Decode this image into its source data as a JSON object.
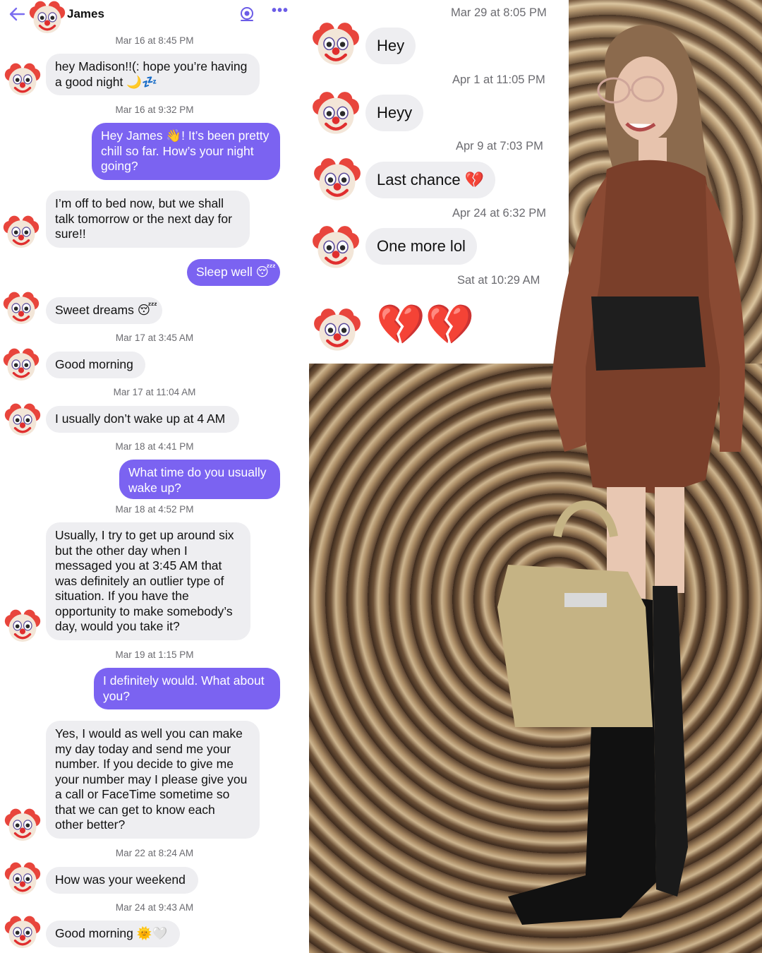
{
  "header": {
    "contact_name": "James",
    "back_icon": "arrow-left-icon",
    "action_icon": "broadcast-icon",
    "more_label": "•••"
  },
  "avatar_emoji": "clown-face-icon",
  "left_thread": [
    {
      "kind": "ts",
      "text": "Mar 16 at 8:45 PM"
    },
    {
      "kind": "in",
      "lines": [
        "hey Madison!!(: hope you’re having",
        "a good night 🌙💤"
      ]
    },
    {
      "kind": "ts",
      "text": "Mar 16 at 9:32 PM"
    },
    {
      "kind": "out",
      "lines": [
        "Hey James 👋! It’s been pretty",
        "chill so far. How’s your night",
        "going?"
      ]
    },
    {
      "kind": "in",
      "lines": [
        "I’m off to bed now, but we shall",
        "talk tomorrow or the next day for",
        "sure!!"
      ]
    },
    {
      "kind": "out",
      "lines": [
        "Sleep well 😴"
      ]
    },
    {
      "kind": "in",
      "lines": [
        "Sweet dreams 😴"
      ]
    },
    {
      "kind": "ts",
      "text": "Mar 17 at 3:45 AM"
    },
    {
      "kind": "in",
      "lines": [
        "Good morning"
      ]
    },
    {
      "kind": "ts",
      "text": "Mar 17 at 11:04 AM"
    },
    {
      "kind": "in",
      "lines": [
        "I usually don’t wake up at 4 AM"
      ]
    },
    {
      "kind": "ts",
      "text": "Mar 18 at 4:41 PM"
    },
    {
      "kind": "out",
      "lines": [
        "What time do you usually",
        "wake up?"
      ]
    },
    {
      "kind": "ts",
      "text": "Mar 18 at 4:52 PM"
    },
    {
      "kind": "in",
      "lines": [
        "Usually, I try to get up around six",
        "but the other day when I",
        "messaged you at 3:45 AM that",
        "was definitely an outlier type of",
        "situation. If you have the",
        "opportunity to make somebody’s",
        "day, would you take it?"
      ]
    },
    {
      "kind": "ts",
      "text": "Mar 19 at 1:15 PM"
    },
    {
      "kind": "out",
      "lines": [
        "I definitely would. What about",
        "you?"
      ]
    },
    {
      "kind": "in",
      "lines": [
        "Yes, I would as well you can make",
        "my day today and send me your",
        "number. If you decide to give me",
        "your number may I please give you",
        "a call or FaceTime sometime so",
        "that we can get to know each",
        "other better?"
      ]
    },
    {
      "kind": "ts",
      "text": "Mar 22 at 8:24 AM"
    },
    {
      "kind": "in",
      "lines": [
        "How was your weekend"
      ]
    },
    {
      "kind": "ts",
      "text": "Mar 24 at 9:43 AM"
    },
    {
      "kind": "in",
      "lines": [
        "Good morning 🌞🤍"
      ]
    }
  ],
  "right_thread": [
    {
      "kind": "ts",
      "text": "Mar 29 at 8:05 PM"
    },
    {
      "kind": "in",
      "text": "Hey"
    },
    {
      "kind": "ts",
      "text": "Apr 1 at 11:05 PM"
    },
    {
      "kind": "in",
      "text": "Heyy"
    },
    {
      "kind": "ts",
      "text": "Apr 9 at 7:03 PM"
    },
    {
      "kind": "in",
      "text": "Last chance 💔"
    },
    {
      "kind": "ts",
      "text": "Apr 24 at 6:32 PM"
    },
    {
      "kind": "in",
      "text": "One more lol"
    },
    {
      "kind": "ts",
      "text": "Sat at 10:29 AM"
    },
    {
      "kind": "emoji",
      "text": "💔💔"
    }
  ],
  "colors": {
    "accent": "#7b63f1",
    "incoming_bubble": "#eeeef1",
    "timestamp": "#6b6b70"
  },
  "photo": {
    "subject": "person-in-snakeskin-outfit-photo"
  }
}
